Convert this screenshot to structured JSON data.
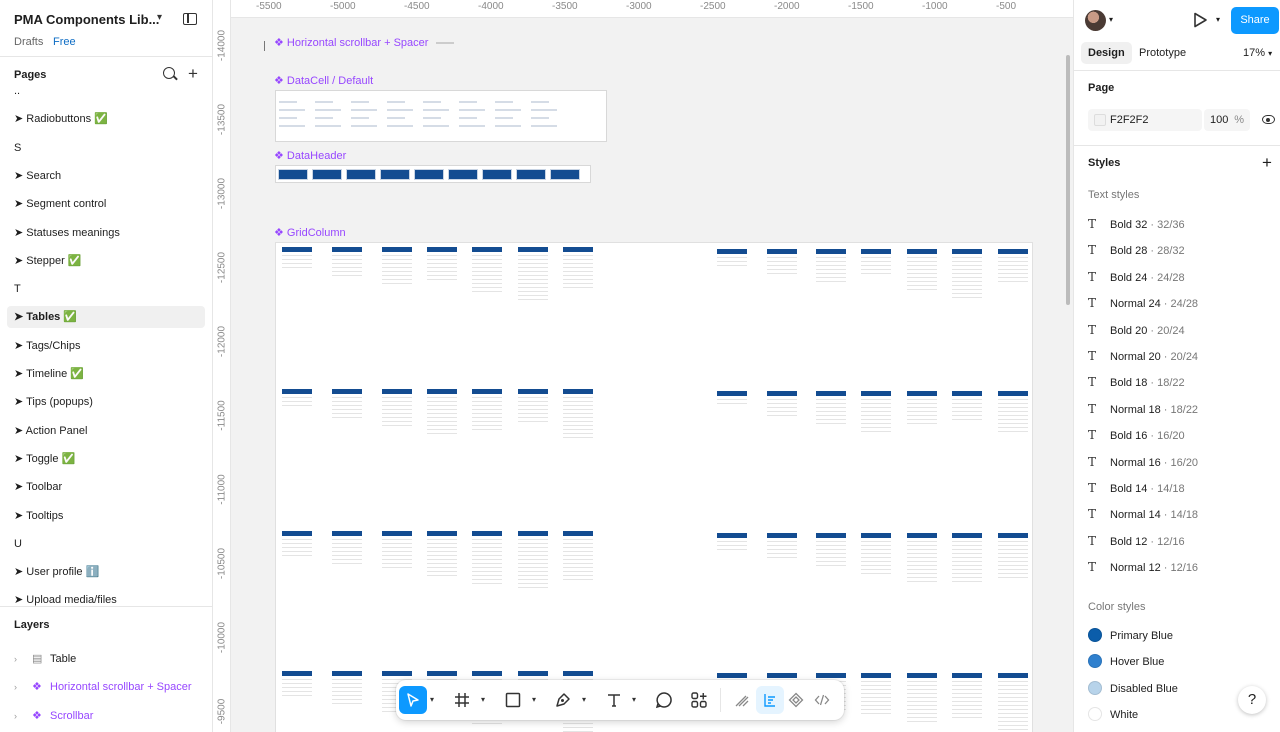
{
  "file": {
    "title": "PMA Components Lib...",
    "location": "Drafts",
    "plan": "Free"
  },
  "pages": {
    "header": "Pages",
    "items": [
      {
        "label": "..",
        "selected": false
      },
      {
        "label": "➤ Radiobuttons ✅",
        "selected": false
      },
      {
        "label": "S",
        "selected": false
      },
      {
        "label": "➤ Search",
        "selected": false
      },
      {
        "label": "➤ Segment control",
        "selected": false
      },
      {
        "label": "➤ Statuses meanings",
        "selected": false
      },
      {
        "label": "➤ Stepper ✅",
        "selected": false
      },
      {
        "label": "T",
        "selected": false
      },
      {
        "label": "➤ Tables ✅",
        "selected": true
      },
      {
        "label": "➤ Tags/Chips",
        "selected": false
      },
      {
        "label": "➤ Timeline ✅",
        "selected": false
      },
      {
        "label": "➤ Tips (popups)",
        "selected": false
      },
      {
        "label": "➤ Action Panel",
        "selected": false
      },
      {
        "label": "➤ Toggle ✅",
        "selected": false
      },
      {
        "label": "➤ Toolbar",
        "selected": false
      },
      {
        "label": "➤ Tooltips",
        "selected": false
      },
      {
        "label": "U",
        "selected": false
      },
      {
        "label": "➤ User profile ℹ️",
        "selected": false
      },
      {
        "label": "➤ Upload media/files",
        "selected": false
      }
    ]
  },
  "layers": {
    "header": "Layers",
    "items": [
      {
        "label": "Table",
        "type": "frame"
      },
      {
        "label": "Horizontal scrollbar + Spacer",
        "type": "component"
      },
      {
        "label": "Scrollbar",
        "type": "component"
      }
    ]
  },
  "canvas": {
    "ruler_x": [
      "-5500",
      "-5000",
      "-4500",
      "-4000",
      "-3500",
      "-3000",
      "-2500",
      "-2000",
      "-1500",
      "-1000",
      "-500"
    ],
    "ruler_y": [
      "-14000",
      "-13500",
      "-13000",
      "-12500",
      "-12000",
      "-11500",
      "-11000",
      "-10500",
      "-10000",
      "-9500"
    ],
    "frame_labels": {
      "hscroll": "❖ Horizontal scrollbar + Spacer",
      "datacell": "❖ DataCell / Default",
      "dataheader": "❖ DataHeader",
      "gridcolumn": "❖ GridColumn"
    },
    "background": "#F2F2F2",
    "table_header_color": "#134C91"
  },
  "toolbar": {
    "tools": [
      "move-icon",
      "frame-icon",
      "rectangle-icon",
      "pen-icon",
      "text-icon",
      "comment-icon",
      "actions-icon"
    ],
    "modes": [
      "draw-mode-icon",
      "design-mode-icon",
      "dev-component-icon",
      "code-icon"
    ]
  },
  "right": {
    "tabs": [
      "Design",
      "Prototype"
    ],
    "active_tab": "Design",
    "share": "Share",
    "zoom": "17%",
    "page_section": "Page",
    "page_color": "F2F2F2",
    "page_opacity": "100",
    "percent": "%",
    "styles_header": "Styles",
    "text_styles_header": "Text styles",
    "text_styles": [
      {
        "name": "Bold 32",
        "size": " · 32/36"
      },
      {
        "name": "Bold 28",
        "size": " · 28/32"
      },
      {
        "name": "Bold 24",
        "size": " · 24/28"
      },
      {
        "name": "Normal 24",
        "size": " · 24/28"
      },
      {
        "name": "Bold 20",
        "size": " · 20/24"
      },
      {
        "name": "Normal 20",
        "size": " · 20/24"
      },
      {
        "name": "Bold 18",
        "size": " · 18/22"
      },
      {
        "name": "Normal 18",
        "size": " · 18/22"
      },
      {
        "name": "Bold 16",
        "size": " · 16/20"
      },
      {
        "name": "Normal 16",
        "size": " · 16/20"
      },
      {
        "name": "Bold 14",
        "size": " · 14/18"
      },
      {
        "name": "Normal 14",
        "size": " · 14/18"
      },
      {
        "name": "Bold 12",
        "size": " · 12/16"
      },
      {
        "name": "Normal 12",
        "size": " · 12/16"
      }
    ],
    "color_styles_header": "Color styles",
    "color_styles": [
      {
        "name": "Primary Blue",
        "color": "#0B5DAA"
      },
      {
        "name": "Hover Blue",
        "color": "#2F80CE"
      },
      {
        "name": "Disabled Blue",
        "color": "#B7D3EA"
      },
      {
        "name": "White",
        "color": "#FFFFFF"
      }
    ],
    "help": "?"
  }
}
